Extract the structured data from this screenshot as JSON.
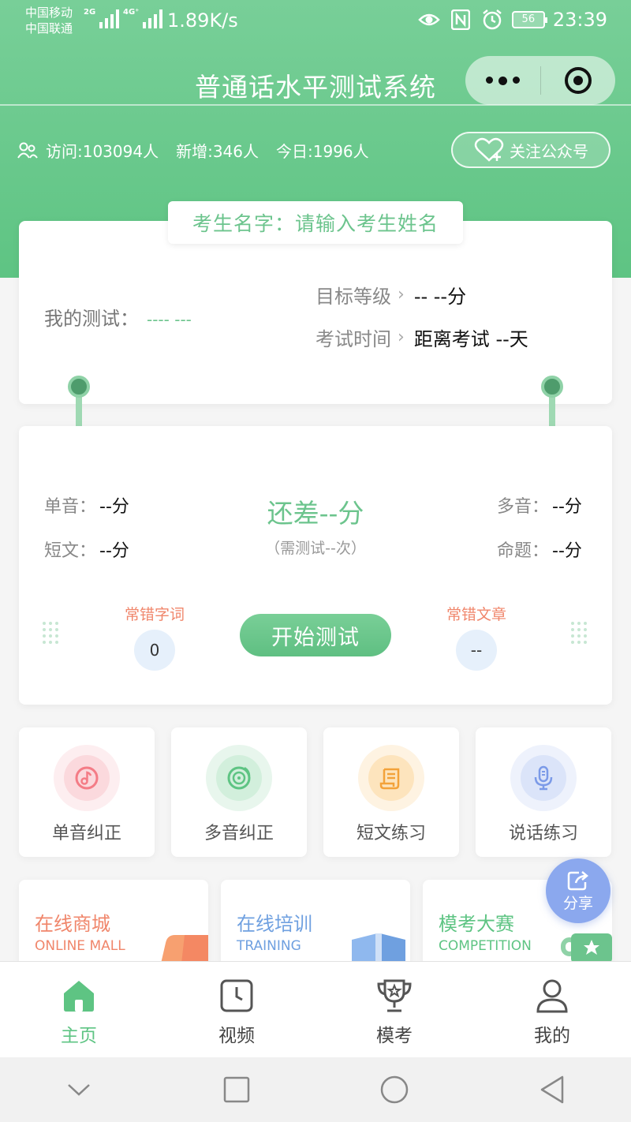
{
  "status_bar": {
    "carrier1": "中国移动",
    "carrier2": "中国联通",
    "net1": "2G",
    "net2": "4G⁺",
    "speed": "1.89K/s",
    "battery": "56",
    "time": "23:39"
  },
  "nav": {
    "title": "普通话水平测试系统",
    "more_icon": "more-dots-icon",
    "close_icon": "miniprogram-close-icon"
  },
  "stats": {
    "visits": "访问:103094人",
    "new": "新增:346人",
    "today": "今日:1996人",
    "follow_label": "关注公众号"
  },
  "profile": {
    "name_label": "考生名字：请输入考生姓名",
    "my_test_label": "我的测试：",
    "my_test_value": "---- ---",
    "target_label": "目标等级",
    "target_value": "-- --分",
    "exam_time_label": "考试时间",
    "exam_time_value": "距离考试 --天"
  },
  "scores": {
    "single_label": "单音：",
    "single_value": "--分",
    "essay_label": "短文：",
    "essay_value": "--分",
    "multi_label": "多音：",
    "multi_value": "--分",
    "topic_label": "命题：",
    "topic_value": "--分",
    "diff_text": "还差--分",
    "need_text": "（需测试--次）",
    "common_words_label": "常错字词",
    "common_words_value": "0",
    "common_articles_label": "常错文章",
    "common_articles_value": "--",
    "start_button": "开始测试"
  },
  "features": [
    {
      "label": "单音纠正",
      "icon": "music-note-icon",
      "color": "#f47c86"
    },
    {
      "label": "多音纠正",
      "icon": "disc-icon",
      "color": "#5ec483"
    },
    {
      "label": "短文练习",
      "icon": "scroll-icon",
      "color": "#f3a23a"
    },
    {
      "label": "说话练习",
      "icon": "microphone-icon",
      "color": "#7b9ae8"
    }
  ],
  "promos": [
    {
      "title": "在线商城",
      "subtitle": "ONLINE MALL",
      "color": "#f0866b"
    },
    {
      "title": "在线培训",
      "subtitle": "TRAINING",
      "color": "#6fa0e0"
    },
    {
      "title": "模考大赛",
      "subtitle": "COMPETITION",
      "color": "#5ec483"
    }
  ],
  "share_label": "分享",
  "tabs": [
    {
      "label": "主页",
      "icon": "home-icon"
    },
    {
      "label": "视频",
      "icon": "clock-icon"
    },
    {
      "label": "模考",
      "icon": "trophy-icon"
    },
    {
      "label": "我的",
      "icon": "user-icon"
    }
  ]
}
